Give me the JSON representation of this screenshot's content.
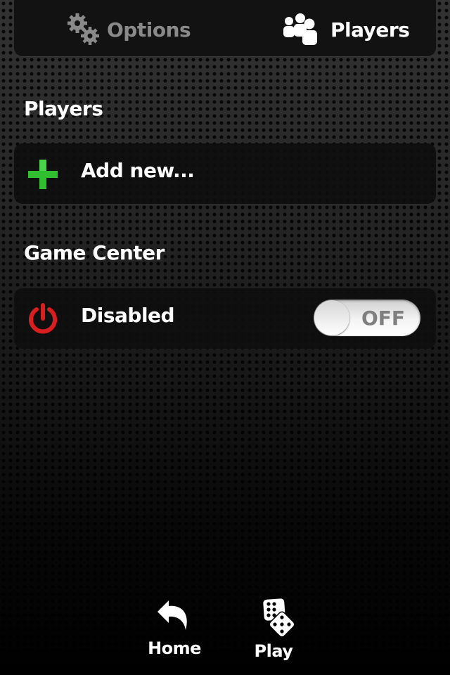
{
  "top_tabs": {
    "options_label": "Options",
    "players_label": "Players",
    "options_icon": "gears-icon",
    "players_icon": "people-icon",
    "active_tab": "Players"
  },
  "players_section": {
    "title": "Players",
    "add_new": {
      "label": "Add new...",
      "icon": "plus-icon",
      "icon_color": "#33cc33"
    }
  },
  "game_center_section": {
    "title": "Game Center",
    "status": {
      "label": "Disabled",
      "icon": "power-icon",
      "icon_color": "#d81e1e"
    },
    "toggle": {
      "state_label": "OFF",
      "on": false
    }
  },
  "bottom_nav": {
    "home_label": "Home",
    "home_icon": "back-arrow-icon",
    "play_label": "Play",
    "play_icon": "dice-icon"
  }
}
